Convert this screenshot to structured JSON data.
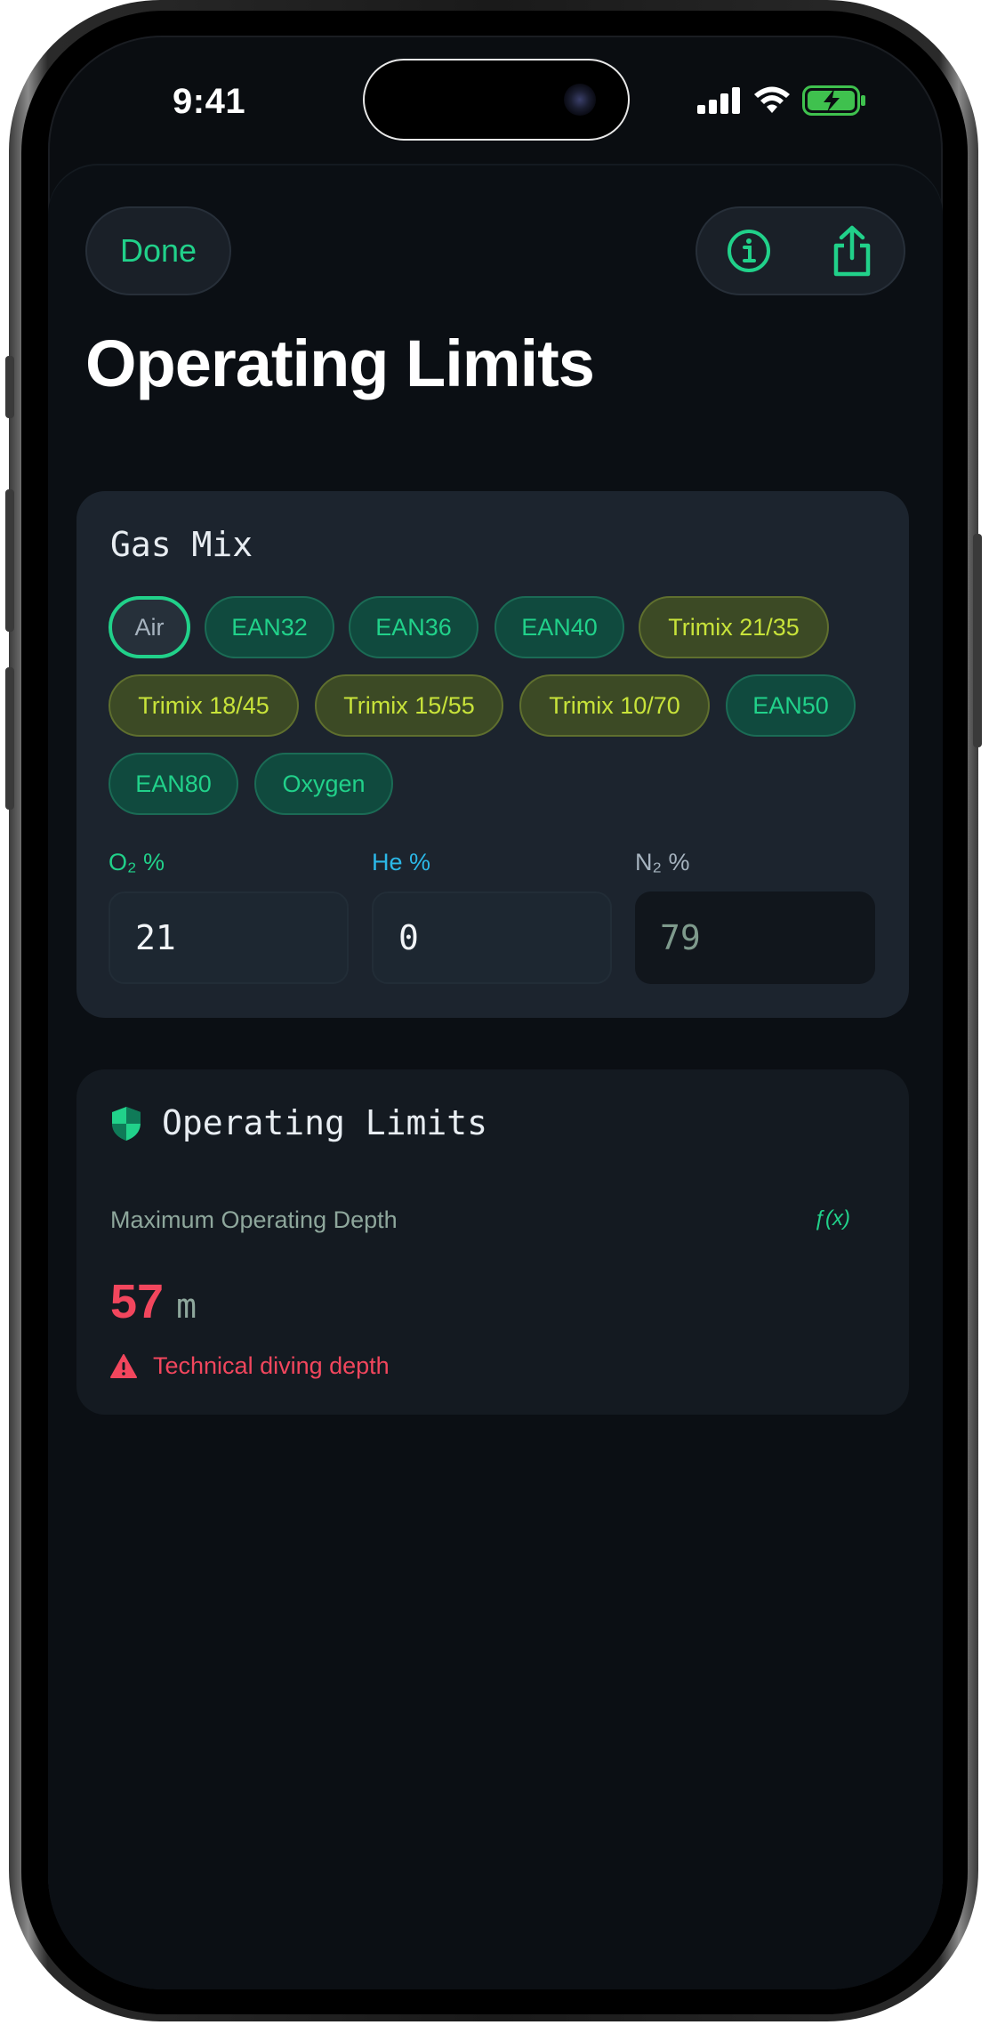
{
  "status_bar": {
    "time": "9:41"
  },
  "header": {
    "done_label": "Done",
    "title": "Operating Limits"
  },
  "gas_mix": {
    "heading": "Gas Mix",
    "presets": [
      {
        "label": "Air",
        "kind": "air",
        "selected": true
      },
      {
        "label": "EAN32",
        "kind": "ean"
      },
      {
        "label": "EAN36",
        "kind": "ean"
      },
      {
        "label": "EAN40",
        "kind": "ean"
      },
      {
        "label": "Trimix 21/35",
        "kind": "trimix"
      },
      {
        "label": "Trimix 18/45",
        "kind": "trimix"
      },
      {
        "label": "Trimix 15/55",
        "kind": "trimix"
      },
      {
        "label": "Trimix 10/70",
        "kind": "trimix"
      },
      {
        "label": "EAN50",
        "kind": "ean"
      },
      {
        "label": "EAN80",
        "kind": "ean"
      },
      {
        "label": "Oxygen",
        "kind": "ean"
      }
    ],
    "o2": {
      "label": "O₂ %",
      "value": "21"
    },
    "he": {
      "label": "He %",
      "value": "0"
    },
    "n2": {
      "label": "N₂ %",
      "value": "79"
    }
  },
  "operating_limits": {
    "heading": "Operating Limits",
    "mod_label": "Maximum Operating Depth",
    "formula_label": "ƒ(x)",
    "mod_value": "57",
    "mod_unit": "m",
    "warning": "Technical diving depth"
  },
  "colors": {
    "accent_green": "#21d18a",
    "accent_blue": "#2bb8e8",
    "trimix_yellow": "#c8e33a",
    "warning_red": "#f2465d",
    "background": "#0b0f14"
  },
  "icons": [
    "info-icon",
    "share-icon",
    "shield-icon",
    "warning-icon",
    "signal-icon",
    "wifi-icon",
    "battery-icon"
  ]
}
